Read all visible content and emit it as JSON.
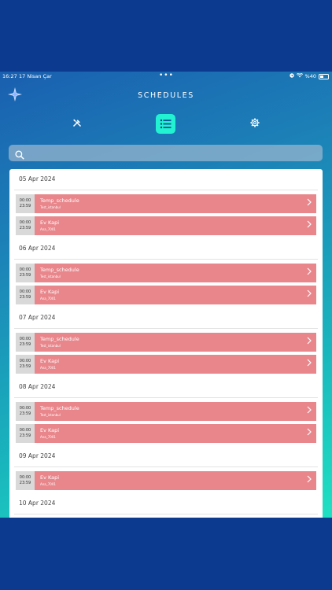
{
  "status": {
    "time": "16:27",
    "date": "17 Nisan Çar",
    "dots": "•••",
    "battery": "%40",
    "battery_level": 0.4
  },
  "header": {
    "title": "SCHEDULES"
  },
  "search": {
    "placeholder": ""
  },
  "days": [
    {
      "date": "05 Apr 2024",
      "items": [
        {
          "start": "00:00",
          "end": "23:59",
          "name": "Temp_schedule",
          "sub": "Test_istanbul"
        },
        {
          "start": "00:00",
          "end": "23:59",
          "name": "Ev Kapi",
          "sub": "Ana_7001"
        }
      ]
    },
    {
      "date": "06 Apr 2024",
      "items": [
        {
          "start": "00:00",
          "end": "23:59",
          "name": "Temp_schedule",
          "sub": "Test_istanbul"
        },
        {
          "start": "00:00",
          "end": "23:59",
          "name": "Ev Kapi",
          "sub": "Ana_7001"
        }
      ]
    },
    {
      "date": "07 Apr 2024",
      "items": [
        {
          "start": "00:00",
          "end": "23:59",
          "name": "Temp_schedule",
          "sub": "Test_istanbul"
        },
        {
          "start": "00:00",
          "end": "23:59",
          "name": "Ev Kapi",
          "sub": "Ana_7001"
        }
      ]
    },
    {
      "date": "08 Apr 2024",
      "items": [
        {
          "start": "00:00",
          "end": "23:59",
          "name": "Temp_schedule",
          "sub": "Test_istanbul"
        },
        {
          "start": "00:00",
          "end": "23:59",
          "name": "Ev Kapi",
          "sub": "Ana_7001"
        }
      ]
    },
    {
      "date": "09 Apr 2024",
      "items": [
        {
          "start": "00:00",
          "end": "23:59",
          "name": "Ev Kapi",
          "sub": "Ana_7001"
        }
      ]
    },
    {
      "date": "10 Apr 2024",
      "items": [
        {
          "start": "",
          "end": "",
          "name": "",
          "sub": ""
        }
      ]
    }
  ],
  "colors": {
    "accent": "#22f1d2",
    "item_bar": "#e8868b",
    "time_box": "#d9d9d9",
    "frame": "#0b3a8f"
  },
  "icons": {
    "logo": "sparkle-logo",
    "tools": "tools-icon",
    "list": "list-icon",
    "settings": "gear-icon",
    "search": "search-icon",
    "chevron": "chevron-right-icon"
  }
}
